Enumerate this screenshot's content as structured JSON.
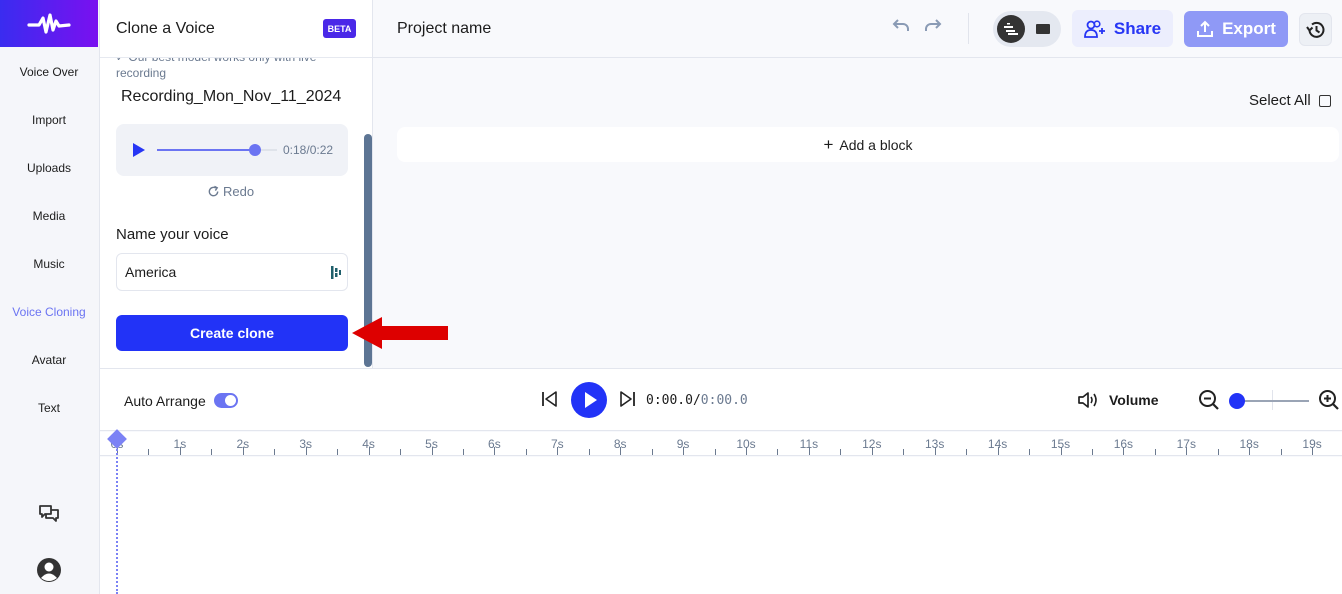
{
  "sidebar": {
    "logo": "waveform-logo",
    "items": [
      {
        "label": "Voice Over",
        "active": false
      },
      {
        "label": "Import",
        "active": false
      },
      {
        "label": "Uploads",
        "active": false
      },
      {
        "label": "Media",
        "active": false
      },
      {
        "label": "Music",
        "active": false
      },
      {
        "label": "Voice Cloning",
        "active": true
      },
      {
        "label": "Avatar",
        "active": false
      },
      {
        "label": "Text",
        "active": false
      }
    ],
    "bottom_icons": [
      "feedback-chat-icon",
      "user-avatar-icon"
    ]
  },
  "clone_panel": {
    "title": "Clone a Voice",
    "badge": "BETA",
    "note": "Our best model works only with live recording",
    "recording_name": "Recording_Mon_Nov_11_2024",
    "player": {
      "time": "0:18/0:22",
      "progress_fraction": 0.82
    },
    "redo_label": "Redo",
    "name_label": "Name your voice",
    "name_value": "America",
    "create_button": "Create clone"
  },
  "header": {
    "project_name": "Project name",
    "share_label": "Share",
    "export_label": "Export"
  },
  "editor": {
    "select_all": "Select All",
    "add_block": "Add a block"
  },
  "timeline": {
    "auto_arrange_label": "Auto Arrange",
    "auto_arrange_on": true,
    "current_time": "0:00.0",
    "separator": "/",
    "total_time": "0:00.0",
    "volume_label": "Volume",
    "ruler_labels": [
      "0s",
      "1s",
      "2s",
      "3s",
      "4s",
      "5s",
      "6s",
      "7s",
      "8s",
      "9s",
      "10s",
      "11s",
      "12s",
      "13s",
      "14s",
      "15s",
      "16s",
      "17s",
      "18s",
      "19s"
    ]
  },
  "colors": {
    "accent": "#2233f7",
    "accent_light": "#6b74f2",
    "annotation_arrow": "#dd0000"
  }
}
